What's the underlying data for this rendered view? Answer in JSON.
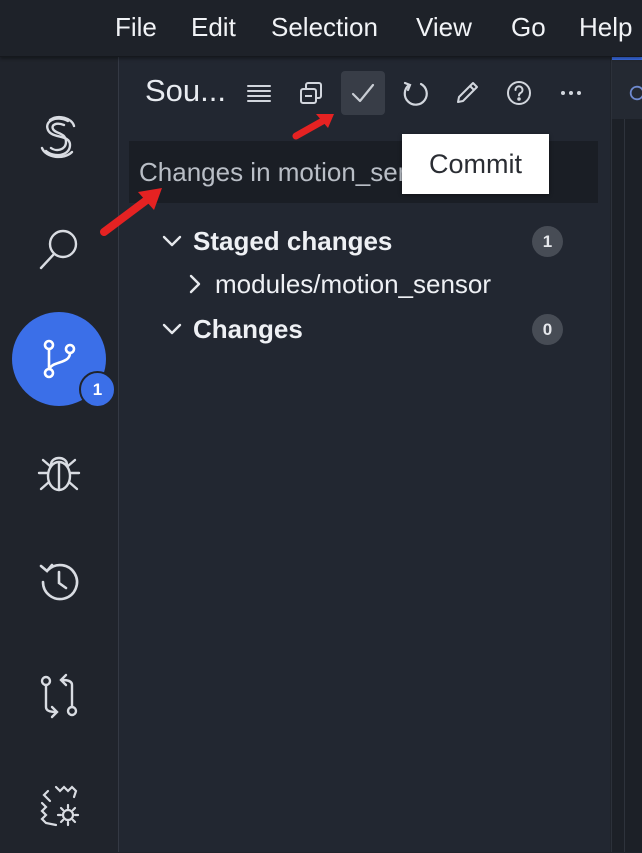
{
  "menu": {
    "items": [
      "File",
      "Edit",
      "Selection",
      "View",
      "Go",
      "Help"
    ]
  },
  "activity": {
    "scm_badge": "1",
    "accent": "#3b6fe8"
  },
  "panel": {
    "title": "Sou...",
    "commit_placeholder": "Changes in motion_sensor",
    "tooltip": "Commit",
    "groups": [
      {
        "label": "Staged changes",
        "count": "1"
      },
      {
        "label": "Changes",
        "count": "0"
      }
    ],
    "staged_items": [
      "modules/motion_sensor"
    ]
  },
  "annotations": {
    "arrow_color": "#e52222"
  }
}
